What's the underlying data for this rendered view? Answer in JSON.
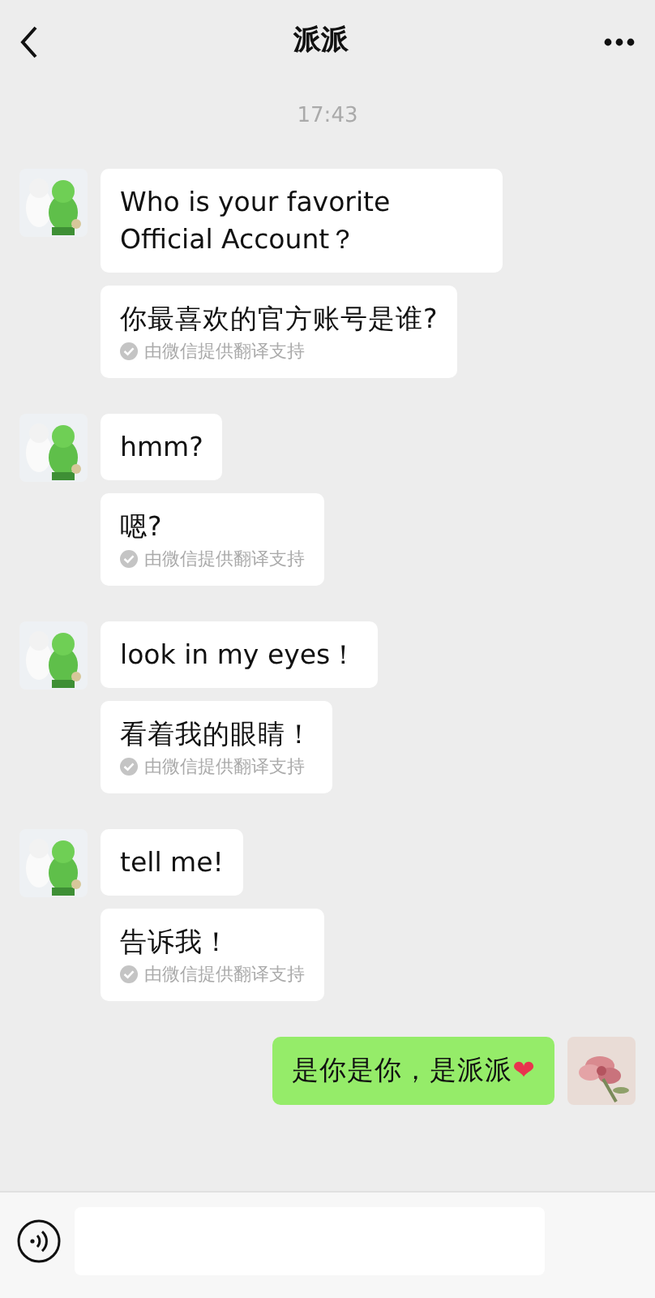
{
  "header": {
    "title": "派派"
  },
  "time": "17:43",
  "messages": [
    {
      "kind": "received",
      "text": "Who is your favorite Official Account？",
      "translation": "你最喜欢的官方账号是谁?",
      "translation_note": "由微信提供翻译支持"
    },
    {
      "kind": "received",
      "text": "hmm?",
      "translation": "嗯?",
      "translation_note": "由微信提供翻译支持"
    },
    {
      "kind": "received",
      "text": "look in my eyes！",
      "translation": "看着我的眼睛！",
      "translation_note": "由微信提供翻译支持"
    },
    {
      "kind": "received",
      "text": "tell me!",
      "translation": "告诉我！",
      "translation_note": "由微信提供翻译支持"
    },
    {
      "kind": "sent",
      "text": "是你是你，是派派",
      "emoji": "❤"
    }
  ]
}
